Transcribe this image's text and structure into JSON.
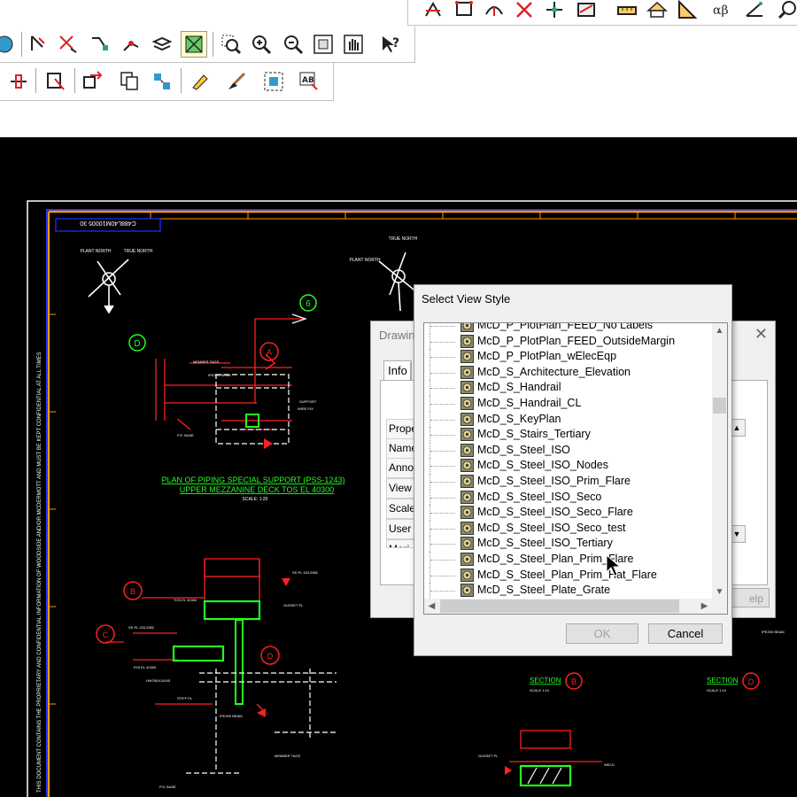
{
  "drawing": {
    "title_block_ref": "C488L40M10005 30",
    "north_plant": "PLANT NORTH",
    "north_true": "TRUE NORTH",
    "plan_title_line1": "PLAN OF PIPING SPECIAL SUPPORT (PSS-1243)",
    "plan_title_line2": "UPPER MEZZANINE DECK TOS EL 40300",
    "plan_scale": "SCALE: 1:20",
    "section_b": "SECTION",
    "section_b_letter": "B",
    "section_b_scale": "SCALE 1:10",
    "section_d": "SECTION",
    "section_d_letter": "D",
    "section_d_scale": "SCALE 1:10",
    "bubble_6": "6",
    "bubble_d": "D",
    "bubble_a": "A",
    "bubble_b": "B",
    "bubble_c": "C",
    "bubble_d2": "D",
    "side_note": "THIS DOCUMENT CONTAINS THE PROPRIETARY AND CONFIDENTIAL INFORMATION OF WOODSIDE AND/OR MCDERMOTT AND MUST BE KEPT CONFIDENTIAL AT ALL TIMES"
  },
  "behind_dialog": {
    "title": "Drawin",
    "tab_info": "Info",
    "rows": [
      "Prope",
      "Name",
      "Anno",
      "View",
      "Scale",
      "User",
      "Mari"
    ],
    "help_label": "elp"
  },
  "dialog": {
    "title": "Select View Style",
    "items": [
      "McD_P_PlotPlan_FEED_No Labels",
      "McD_P_PlotPlan_FEED_OutsideMargin",
      "McD_P_PlotPlan_wElecEqp",
      "McD_S_Architecture_Elevation",
      "McD_S_Handrail",
      "McD_S_Handrail_CL",
      "McD_S_KeyPlan",
      "McD_S_Stairs_Tertiary",
      "McD_S_Steel_ISO",
      "McD_S_Steel_ISO_Nodes",
      "McD_S_Steel_ISO_Prim_Flare",
      "McD_S_Steel_ISO_Seco",
      "McD_S_Steel_ISO_Seco_Flare",
      "McD_S_Steel_ISO_Seco_test",
      "McD_S_Steel_ISO_Tertiary",
      "McD_S_Steel_Plan_Prim_Flare",
      "McD_S_Steel_Plan_Prim_Hat_Flare",
      "McD_S_Steel_Plate_Grate"
    ],
    "ok_label": "OK",
    "cancel_label": "Cancel"
  },
  "colors": {
    "canvas_bg": "#000000",
    "red": "#ff2020",
    "green": "#22ff22",
    "white": "#ffffff",
    "orange": "#ff9900",
    "blue": "#2233ff"
  }
}
